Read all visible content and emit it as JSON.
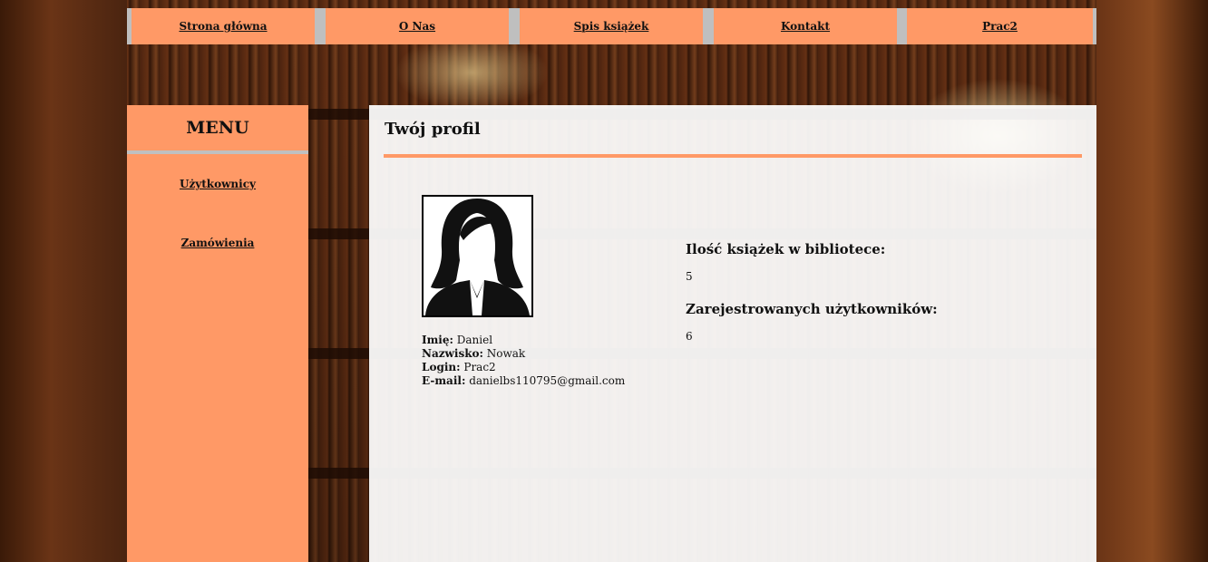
{
  "nav": {
    "items": [
      {
        "label": "Strona główna"
      },
      {
        "label": "O Nas"
      },
      {
        "label": "Spis książek"
      },
      {
        "label": "Kontakt"
      },
      {
        "label": "Prac2"
      }
    ]
  },
  "sidebar": {
    "title": "MENU",
    "items": [
      {
        "label": "Użytkownicy"
      },
      {
        "label": "Zamówienia"
      }
    ]
  },
  "profile": {
    "heading": "Twój profil",
    "first_name_label": "Imię:",
    "first_name": "Daniel",
    "last_name_label": "Nazwisko:",
    "last_name": "Nowak",
    "login_label": "Login:",
    "login": "Prac2",
    "email_label": "E-mail:",
    "email": "danielbs110795@gmail.com"
  },
  "stats": {
    "books_label": "Ilość książek w bibliotece:",
    "books_value": "5",
    "users_label": "Zarejestrowanych użytkowników:",
    "users_value": "6"
  },
  "colors": {
    "accent": "#ff9966",
    "separator": "#bfbfbf"
  }
}
